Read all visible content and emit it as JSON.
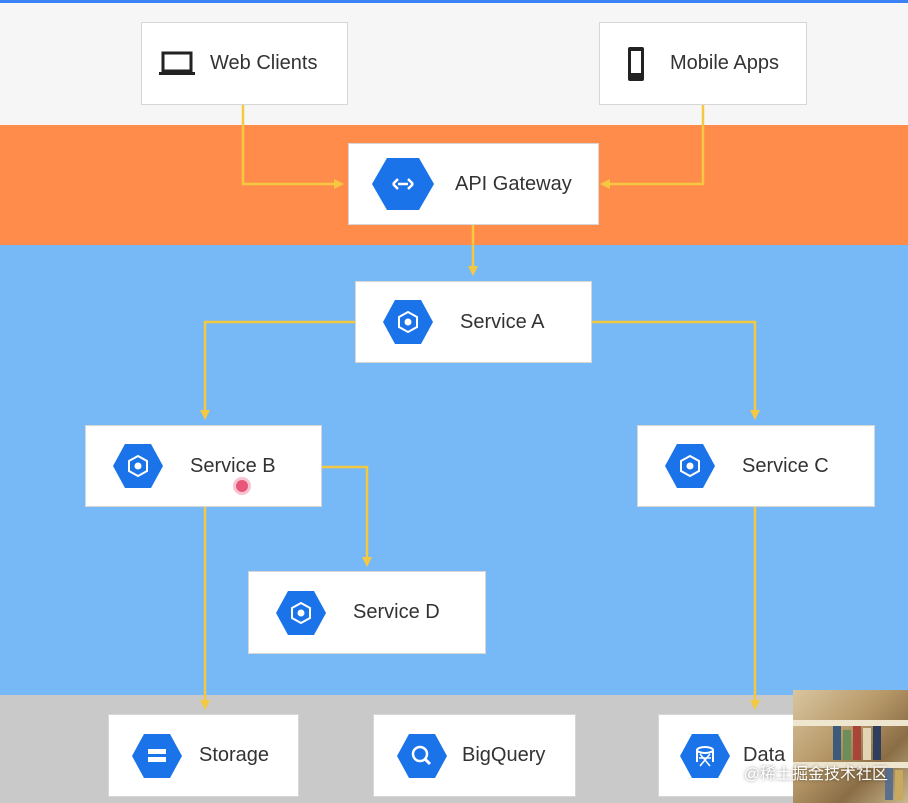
{
  "nodes": {
    "web_clients": {
      "label": "Web Clients",
      "icon": "laptop-icon"
    },
    "mobile_apps": {
      "label": "Mobile Apps",
      "icon": "smartphone-icon"
    },
    "api_gateway": {
      "label": "API Gateway",
      "icon": "api-endpoints-icon"
    },
    "service_a": {
      "label": "Service A",
      "icon": "compute-engine-icon"
    },
    "service_b": {
      "label": "Service B",
      "icon": "compute-engine-icon"
    },
    "service_c": {
      "label": "Service C",
      "icon": "compute-engine-icon"
    },
    "service_d": {
      "label": "Service D",
      "icon": "compute-engine-icon"
    },
    "storage": {
      "label": "Storage",
      "icon": "cloud-storage-icon"
    },
    "bigquery": {
      "label": "BigQuery",
      "icon": "bigquery-icon"
    },
    "datastore": {
      "label": "Data",
      "icon": "datastore-icon"
    }
  },
  "watermark": "@稀土掘金技术社区",
  "colors": {
    "client_band": "#f6f6f6",
    "gateway_band": "#ff8c4a",
    "services_band": "#77b8f6",
    "storage_band": "#c9c9c9",
    "connector": "#f5c842",
    "icon_hex": "#1a73e8"
  }
}
